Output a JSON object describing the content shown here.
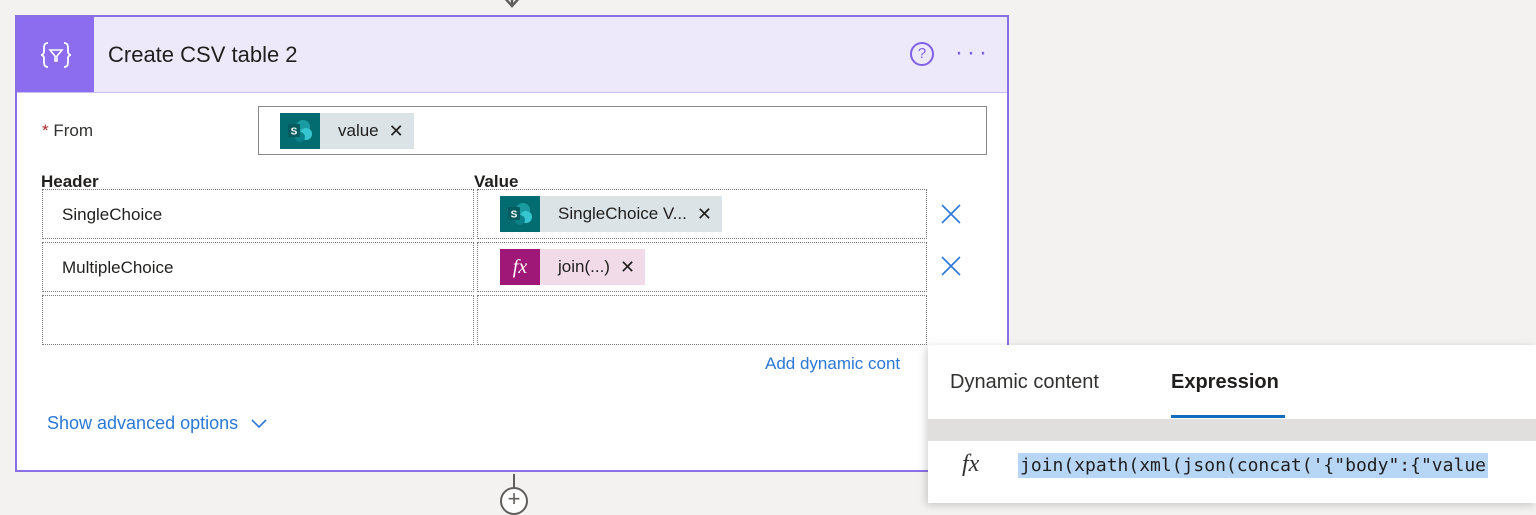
{
  "card": {
    "title": "Create CSV table 2",
    "help_label": "?",
    "more_label": "···",
    "accent_color": "#8c6df0"
  },
  "from": {
    "required_mark": "*",
    "label": "From",
    "token": {
      "text": "value",
      "remove": "✕",
      "source": "SharePoint"
    }
  },
  "table": {
    "header_label": "Header",
    "value_label": "Value",
    "rows": [
      {
        "header": "SingleChoice",
        "value_token": {
          "type": "sharepoint",
          "text": "SingleChoice V...",
          "remove": "✕"
        }
      },
      {
        "header": "MultipleChoice",
        "value_token": {
          "type": "expression",
          "icon": "fx",
          "text": "join(...)",
          "remove": "✕"
        }
      },
      {
        "header": "",
        "value_token": null
      }
    ]
  },
  "add_dynamic": "Add dynamic cont",
  "advanced": {
    "label": "Show advanced options"
  },
  "add_step": "+",
  "flyout": {
    "tabs": [
      "Dynamic content",
      "Expression"
    ],
    "active_tab": "Expression",
    "fx_icon": "fx",
    "expression": "join(xpath(xml(json(concat('{\"body\":{\"value"
  }
}
